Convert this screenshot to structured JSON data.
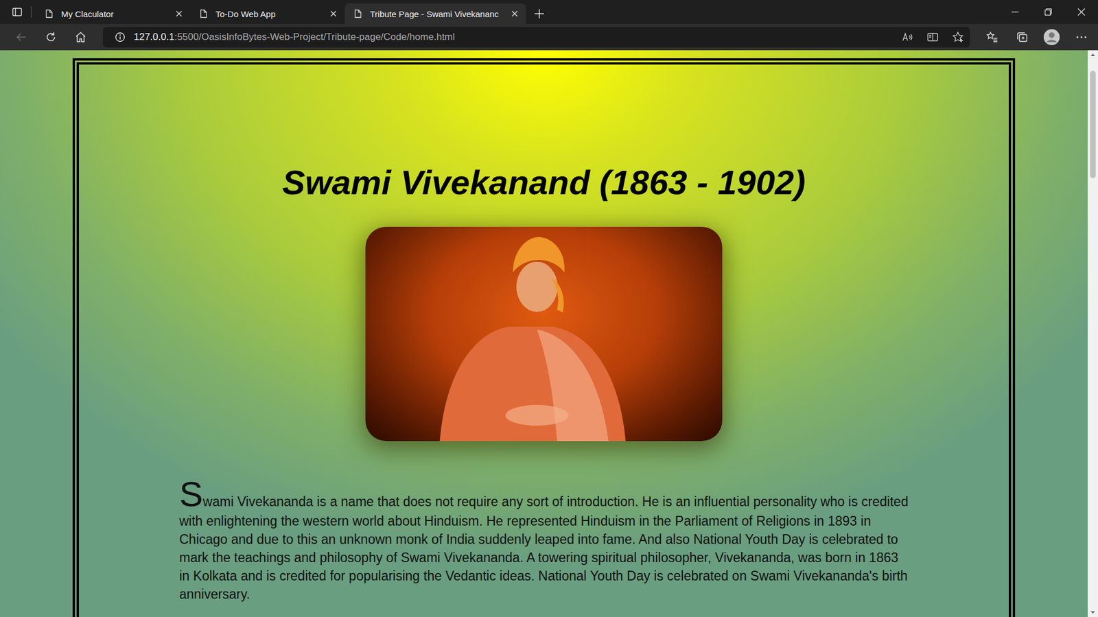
{
  "tabs": [
    {
      "label": "My Claculator",
      "selected": false
    },
    {
      "label": "To-Do Web App",
      "selected": false
    },
    {
      "label": "Tribute Page - Swami Vivekananc",
      "selected": true
    }
  ],
  "toolbar": {
    "back": {
      "disabled": true
    }
  },
  "address": {
    "host": "127.0.0.1",
    "path": ":5500/OasisInfoBytes-Web-Project/Tribute-page/Code/home.html"
  },
  "page": {
    "heading": "Swami Vivekanand (1863 - 1902)",
    "paragraph": "Swami Vivekananda is a name that does not require any sort of introduction. He is an influential personality who is credited with enlightening the western world about Hinduism. He represented Hinduism in the Parliament of Religions in 1893 in Chicago and due to this an unknown monk of India suddenly leaped into fame. And also National Youth Day is celebrated to mark the teachings and philosophy of Swami Vivekananda. A towering spiritual philosopher, Vivekananda, was born in 1863 in Kolkata and is credited for popularising the Vedantic ideas. National Youth Day is celebrated on Swami Vivekananda's birth anniversary."
  },
  "scrollbar": {
    "level": 0.2
  }
}
